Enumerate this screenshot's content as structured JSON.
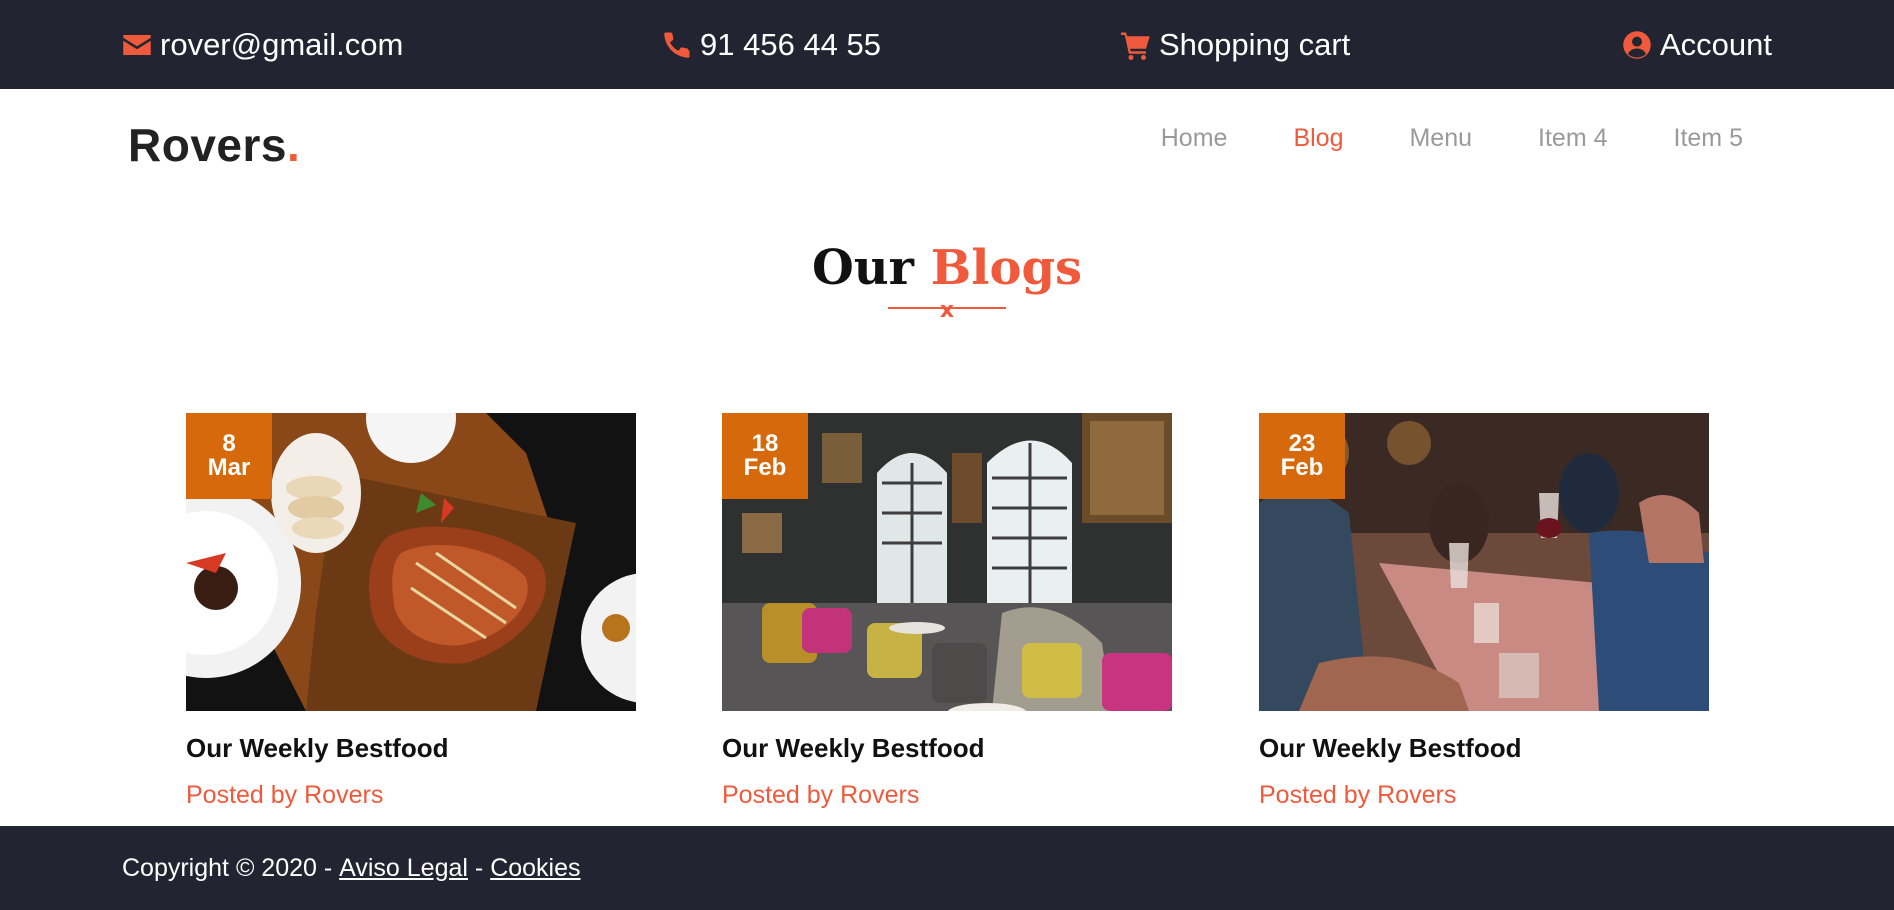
{
  "topbar": {
    "email": "rover@gmail.com",
    "phone": "91 456 44 55",
    "cart": "Shopping cart",
    "account": "Account",
    "icons": [
      "envelope-icon",
      "phone-icon",
      "cart-icon",
      "user-circle-icon"
    ],
    "icon_color": "#f05a3c",
    "background": "#222531"
  },
  "brand": {
    "name": "Rovers",
    "dot": "."
  },
  "nav": {
    "items": [
      "Home",
      "Blog",
      "Menu",
      "Item 4",
      "Item 5"
    ],
    "active": "Blog",
    "active_color": "#f05a3c"
  },
  "section": {
    "title_plain": "Our",
    "title_accent": "Blogs",
    "divider_mark": "x"
  },
  "posts": [
    {
      "day": "8",
      "month": "Mar",
      "title": "Our Weekly Bestfood",
      "meta": "Posted by Rovers",
      "image": "grilled-food-on-board-image"
    },
    {
      "day": "18",
      "month": "Feb",
      "title": "Our Weekly Bestfood",
      "meta": "Posted by Rovers",
      "image": "restaurant-interior-image"
    },
    {
      "day": "23",
      "month": "Feb",
      "title": "Our Weekly Bestfood",
      "meta": "Posted by Rovers",
      "image": "friends-dining-image"
    }
  ],
  "badge_color": "#d6690b",
  "footer": {
    "copyright": "Copyright © 2020 -",
    "link1": "Aviso Legal",
    "separator": "-",
    "link2": "Cookies"
  }
}
